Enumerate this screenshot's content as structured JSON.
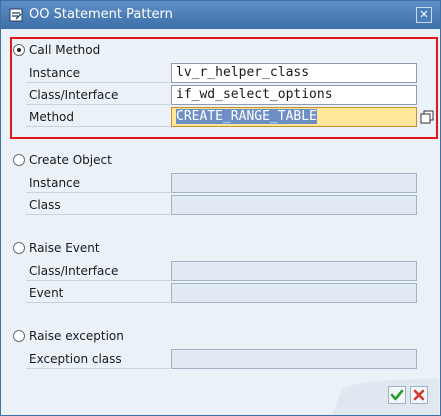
{
  "window": {
    "title": "OO Statement Pattern"
  },
  "sections": {
    "call_method": {
      "label": "Call Method",
      "selected": true,
      "fields": {
        "instance": {
          "label": "Instance",
          "value": "lv_r_helper_class"
        },
        "class_interface": {
          "label": "Class/Interface",
          "value": "if_wd_select_options"
        },
        "method": {
          "label": "Method",
          "value": "CREATE_RANGE_TABLE"
        }
      }
    },
    "create_object": {
      "label": "Create Object",
      "selected": false,
      "fields": {
        "instance": {
          "label": "Instance",
          "value": ""
        },
        "class": {
          "label": "Class",
          "value": ""
        }
      }
    },
    "raise_event": {
      "label": "Raise Event",
      "selected": false,
      "fields": {
        "class_interface": {
          "label": "Class/Interface",
          "value": ""
        },
        "event": {
          "label": "Event",
          "value": ""
        }
      }
    },
    "raise_exception": {
      "label": "Raise exception",
      "selected": false,
      "fields": {
        "exception_class": {
          "label": "Exception class",
          "value": ""
        }
      }
    }
  },
  "colors": {
    "title_bar": "#3d6fa8",
    "highlight_border": "#e0161b",
    "focused_field": "#ffe79a",
    "ok_green": "#2e9b2e",
    "cancel_red": "#d23a2a"
  },
  "icons": {
    "title": "statement-pattern-icon",
    "close": "close-icon",
    "value_help": "value-help-icon",
    "ok": "checkmark-icon",
    "cancel": "cancel-x-icon"
  }
}
